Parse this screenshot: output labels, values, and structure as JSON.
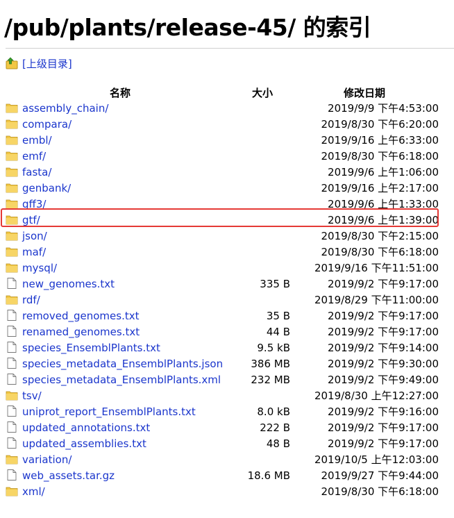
{
  "title": "/pub/plants/release-45/ 的索引",
  "parent_link": "[上级目录]",
  "columns": {
    "name": "名称",
    "size": "大小",
    "date": "修改日期"
  },
  "entries": [
    {
      "name": "assembly_chain/",
      "type": "folder",
      "size": "",
      "date": "2019/9/9 下午4:53:00"
    },
    {
      "name": "compara/",
      "type": "folder",
      "size": "",
      "date": "2019/8/30 下午6:20:00"
    },
    {
      "name": "embl/",
      "type": "folder",
      "size": "",
      "date": "2019/9/16 上午6:33:00"
    },
    {
      "name": "emf/",
      "type": "folder",
      "size": "",
      "date": "2019/8/30 下午6:18:00"
    },
    {
      "name": "fasta/",
      "type": "folder",
      "size": "",
      "date": "2019/9/6 上午1:06:00"
    },
    {
      "name": "genbank/",
      "type": "folder",
      "size": "",
      "date": "2019/9/16 上午2:17:00"
    },
    {
      "name": "gff3/",
      "type": "folder",
      "size": "",
      "date": "2019/9/6 上午1:33:00"
    },
    {
      "name": "gtf/",
      "type": "folder",
      "size": "",
      "date": "2019/9/6 上午1:39:00"
    },
    {
      "name": "json/",
      "type": "folder",
      "size": "",
      "date": "2019/8/30 下午2:15:00"
    },
    {
      "name": "maf/",
      "type": "folder",
      "size": "",
      "date": "2019/8/30 下午6:18:00"
    },
    {
      "name": "mysql/",
      "type": "folder",
      "size": "",
      "date": "2019/9/16 下午11:51:00"
    },
    {
      "name": "new_genomes.txt",
      "type": "file",
      "size": "335 B",
      "date": "2019/9/2 下午9:17:00"
    },
    {
      "name": "rdf/",
      "type": "folder",
      "size": "",
      "date": "2019/8/29 下午11:00:00"
    },
    {
      "name": "removed_genomes.txt",
      "type": "file",
      "size": "35 B",
      "date": "2019/9/2 下午9:17:00"
    },
    {
      "name": "renamed_genomes.txt",
      "type": "file",
      "size": "44 B",
      "date": "2019/9/2 下午9:17:00"
    },
    {
      "name": "species_EnsemblPlants.txt",
      "type": "file",
      "size": "9.5 kB",
      "date": "2019/9/2 下午9:14:00"
    },
    {
      "name": "species_metadata_EnsemblPlants.json",
      "type": "file",
      "size": "386 MB",
      "date": "2019/9/2 下午9:30:00"
    },
    {
      "name": "species_metadata_EnsemblPlants.xml",
      "type": "file",
      "size": "232 MB",
      "date": "2019/9/2 下午9:49:00"
    },
    {
      "name": "tsv/",
      "type": "folder",
      "size": "",
      "date": "2019/8/30 上午12:27:00"
    },
    {
      "name": "uniprot_report_EnsemblPlants.txt",
      "type": "file",
      "size": "8.0 kB",
      "date": "2019/9/2 下午9:16:00"
    },
    {
      "name": "updated_annotations.txt",
      "type": "file",
      "size": "222 B",
      "date": "2019/9/2 下午9:17:00"
    },
    {
      "name": "updated_assemblies.txt",
      "type": "file",
      "size": "48 B",
      "date": "2019/9/2 下午9:17:00"
    },
    {
      "name": "variation/",
      "type": "folder",
      "size": "",
      "date": "2019/10/5 上午12:03:00"
    },
    {
      "name": "web_assets.tar.gz",
      "type": "file",
      "size": "18.6 MB",
      "date": "2019/9/27 下午9:44:00"
    },
    {
      "name": "xml/",
      "type": "folder",
      "size": "",
      "date": "2019/8/30 下午6:18:00"
    }
  ],
  "highlighted_entry": "gtf/",
  "colors": {
    "link": "#1a35cc",
    "highlight": "#e53935",
    "folder": "#f2c744"
  }
}
